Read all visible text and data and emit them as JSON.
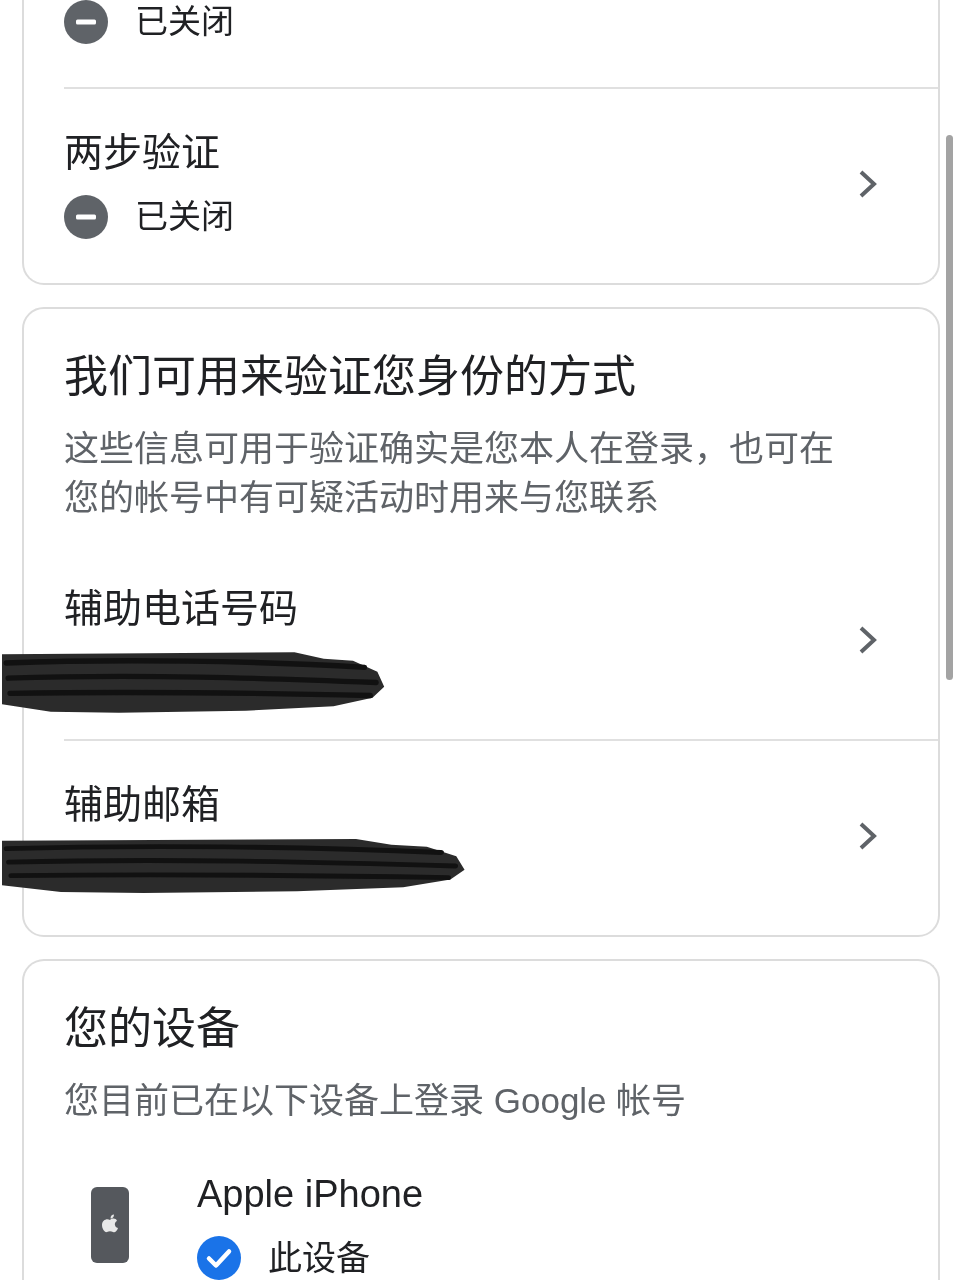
{
  "sections": [
    {
      "kind": "settings",
      "rows": [
        {
          "status": {
            "text": "已关闭",
            "on": false
          }
        },
        {
          "title": "两步验证",
          "status": {
            "text": "已关闭",
            "on": false
          }
        }
      ]
    },
    {
      "kind": "settings",
      "title": "我们可用来验证您身份的方式",
      "description": "这些信息可用于验证确实是您本人在登录，也可在您的帐号中有可疑活动时用来与您联系",
      "rows": [
        {
          "title": "辅助电话号码",
          "redacted": true
        },
        {
          "title": "辅助邮箱",
          "redacted": true
        }
      ]
    },
    {
      "kind": "devices",
      "title": "您的设备",
      "description": "您目前已在以下设备上登录 Google 帐号",
      "devices": [
        {
          "name": "Apple iPhone",
          "this_device": true,
          "label": "此设备"
        }
      ]
    }
  ]
}
